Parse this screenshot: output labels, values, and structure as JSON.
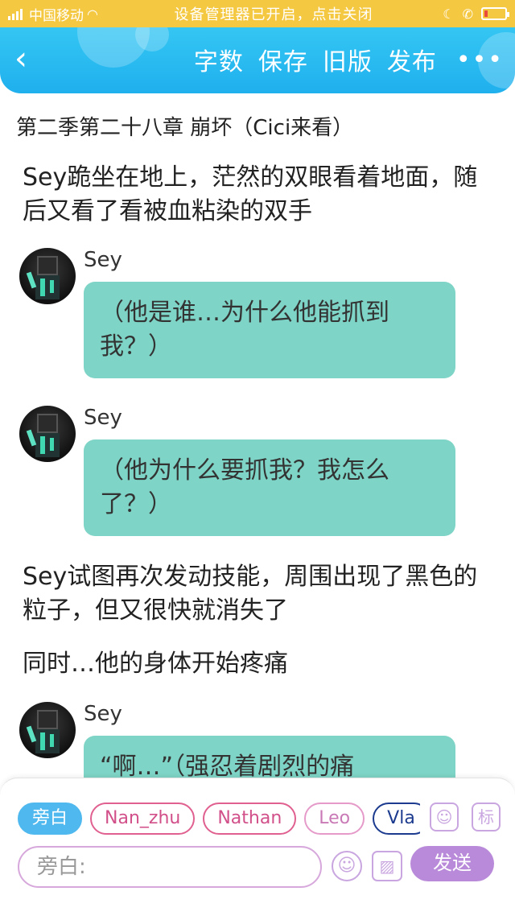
{
  "status_bar": {
    "carrier": "中国移动",
    "notice": "设备管理器已开启，点击关闭",
    "battery_level": 0.15
  },
  "header": {
    "actions": [
      "字数",
      "保存",
      "旧版",
      "发布"
    ],
    "more_label": "•••",
    "back_label": "‹"
  },
  "chapter_title": "第二季第二十八章 崩坏（Cici来看）",
  "narration_1": "Sey跪坐在地上，茫然的双眼看着地面，随后又看了看被血粘染的双手",
  "messages": [
    {
      "name": "Sey",
      "text": "（他是谁…为什么他能抓到我？）"
    },
    {
      "name": "Sey",
      "text": "（他为什么要抓我？我怎么了？）"
    },
    {
      "name": "Sey",
      "text": "“啊…”（强忍着剧烈的痛"
    }
  ],
  "narration_2": "Sey试图再次发动技能，周围出现了黑色的粒子，但又很快就消失了",
  "narration_3": "同时…他的身体开始疼痛",
  "roles": {
    "items": [
      "旁白",
      "Nan_zhu",
      "Nathan",
      "Leo",
      "Vla"
    ],
    "active_index": 0
  },
  "toolbar": {
    "portrait_icon": "portrait-icon",
    "tag_label": "标",
    "emoji_icon": "smiley-icon",
    "image_icon": "image-icon"
  },
  "input": {
    "placeholder": "旁白:",
    "value": ""
  },
  "send_label": "发送",
  "colors": {
    "status_bar": "#f5c842",
    "header": "#1fb0ee",
    "bubble": "#7ed4c6",
    "active_chip": "#4fb8ee",
    "send_button": "#b98ad9"
  }
}
